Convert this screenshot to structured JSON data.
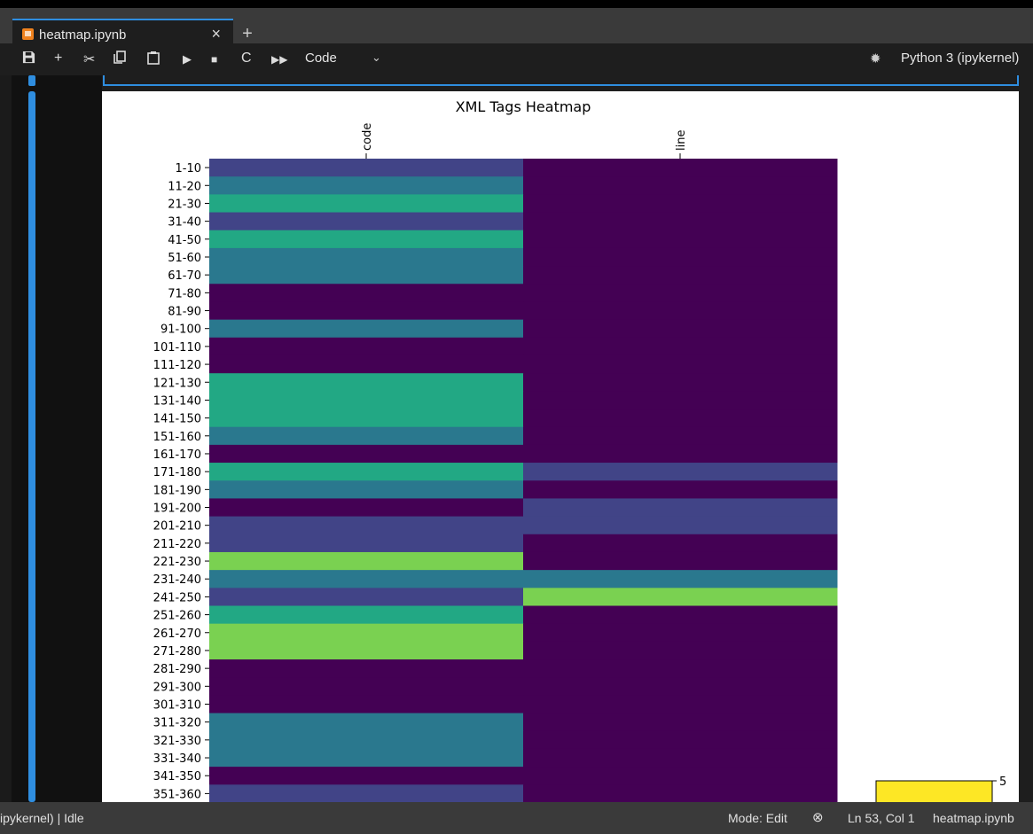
{
  "tab": {
    "title": "heatmap.ipynb",
    "close": "×",
    "new_tab": "+"
  },
  "toolbar": {
    "icons": [
      "save-icon",
      "add-cell-icon",
      "cut-icon",
      "copy-icon",
      "paste-icon",
      "run-icon",
      "stop-icon",
      "restart-icon",
      "run-all-icon"
    ],
    "cell_type": "Code",
    "kernel": "Python 3 (ipykernel)"
  },
  "status": {
    "left": "ipykernel) | Idle",
    "mode": "Mode: Edit",
    "position": "Ln 53, Col 1",
    "filename": "heatmap.ipynb"
  },
  "chart_data": [
    {
      "type": "heatmap",
      "title": "XML Tags Heatmap",
      "x": [
        "code",
        "line"
      ],
      "y": [
        "1-10",
        "11-20",
        "21-30",
        "31-40",
        "41-50",
        "51-60",
        "61-70",
        "71-80",
        "81-90",
        "91-100",
        "101-110",
        "111-120",
        "121-130",
        "131-140",
        "141-150",
        "151-160",
        "161-170",
        "171-180",
        "181-190",
        "191-200",
        "201-210",
        "211-220",
        "221-230",
        "231-240",
        "241-250",
        "251-260",
        "261-270",
        "271-280",
        "281-290",
        "291-300",
        "301-310",
        "311-320",
        "321-330",
        "331-340",
        "341-350",
        "351-360"
      ],
      "values": [
        [
          1,
          0
        ],
        [
          2,
          0
        ],
        [
          3,
          0
        ],
        [
          1,
          0
        ],
        [
          3,
          0
        ],
        [
          2,
          0
        ],
        [
          2,
          0
        ],
        [
          0,
          0
        ],
        [
          0,
          0
        ],
        [
          2,
          0
        ],
        [
          0,
          0
        ],
        [
          0,
          0
        ],
        [
          3,
          0
        ],
        [
          3,
          0
        ],
        [
          3,
          0
        ],
        [
          2,
          0
        ],
        [
          0,
          0
        ],
        [
          3,
          1
        ],
        [
          2,
          0
        ],
        [
          0,
          1
        ],
        [
          1,
          1
        ],
        [
          1,
          0
        ],
        [
          4,
          0
        ],
        [
          2,
          2
        ],
        [
          1,
          4
        ],
        [
          3,
          0
        ],
        [
          4,
          0
        ],
        [
          4,
          0
        ],
        [
          0,
          0
        ],
        [
          0,
          0
        ],
        [
          0,
          0
        ],
        [
          2,
          0
        ],
        [
          2,
          0
        ],
        [
          2,
          0
        ],
        [
          0,
          0
        ],
        [
          1,
          0
        ]
      ],
      "colormap": [
        "#440154",
        "#414487",
        "#2a788e",
        "#22a884",
        "#7ad151"
      ],
      "x_tick_position": "top"
    },
    {
      "type": "bar",
      "values": [
        5
      ],
      "color": "#fde725",
      "tick_labels": [
        "5"
      ]
    }
  ]
}
